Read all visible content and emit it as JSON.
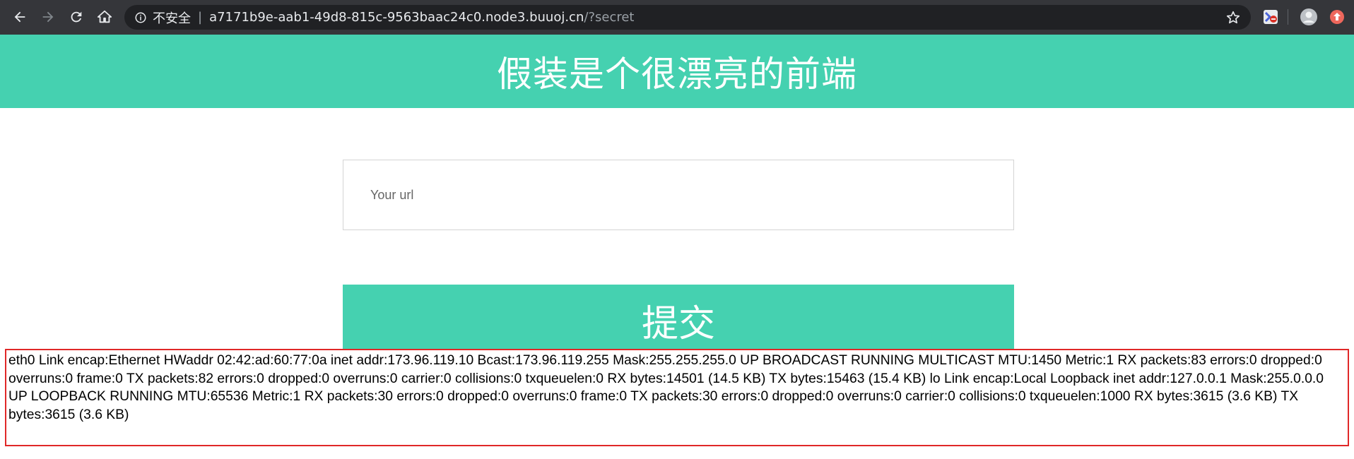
{
  "browser": {
    "security_label": "不安全",
    "url_host": "a7171b9e-aab1-49d8-815c-9563baac24c0.node3.buuoj.cn",
    "url_path": "/?secret"
  },
  "page": {
    "title": "假装是个很漂亮的前端",
    "url_input_placeholder": "Your url",
    "submit_label": "提交",
    "output_text": "eth0 Link encap:Ethernet HWaddr 02:42:ad:60:77:0a inet addr:173.96.119.10 Bcast:173.96.119.255 Mask:255.255.255.0 UP BROADCAST RUNNING MULTICAST MTU:1450 Metric:1 RX packets:83 errors:0 dropped:0 overruns:0 frame:0 TX packets:82 errors:0 dropped:0 overruns:0 carrier:0 collisions:0 txqueuelen:0 RX bytes:14501 (14.5 KB) TX bytes:15463 (15.4 KB) lo Link encap:Local Loopback inet addr:127.0.0.1 Mask:255.0.0.0 UP LOOPBACK RUNNING MTU:65536 Metric:1 RX packets:30 errors:0 dropped:0 overruns:0 frame:0 TX packets:30 errors:0 dropped:0 overruns:0 carrier:0 collisions:0 txqueuelen:1000 RX bytes:3615 (3.6 KB) TX bytes:3615 (3.6 KB)"
  },
  "icons": {
    "back": "back-arrow-icon",
    "forward": "forward-arrow-icon",
    "reload": "reload-icon",
    "home": "home-icon",
    "info": "info-icon",
    "star": "star-icon",
    "extension": "extension-icon",
    "profile": "profile-avatar-icon",
    "update": "update-icon"
  },
  "colors": {
    "accent": "#45d1b0",
    "toolbar": "#35363a",
    "omnibox": "#202124",
    "output_border": "#e02828"
  }
}
